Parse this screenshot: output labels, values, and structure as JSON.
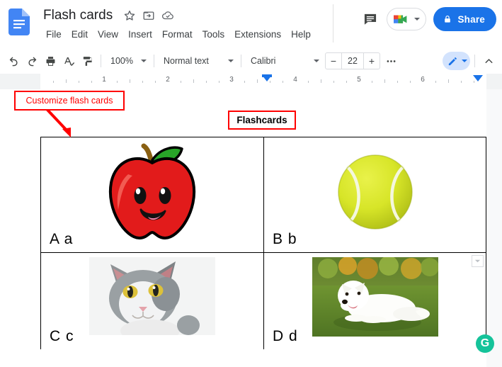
{
  "app": {
    "name": "Google Docs",
    "doc_title": "Flash cards",
    "docs_icon": "google-docs-icon"
  },
  "title_bar": {
    "icons": [
      {
        "name": "star-icon",
        "label": "Star"
      },
      {
        "name": "move-folder-icon",
        "label": "Move"
      },
      {
        "name": "cloud-saved-icon",
        "label": "Saved to Drive"
      }
    ]
  },
  "menu": {
    "items": [
      {
        "id": "file",
        "label": "File"
      },
      {
        "id": "edit",
        "label": "Edit"
      },
      {
        "id": "view",
        "label": "View"
      },
      {
        "id": "insert",
        "label": "Insert"
      },
      {
        "id": "format",
        "label": "Format"
      },
      {
        "id": "tools",
        "label": "Tools"
      },
      {
        "id": "extensions",
        "label": "Extensions"
      },
      {
        "id": "help",
        "label": "Help"
      }
    ]
  },
  "header_actions": {
    "comment_icon": "comment-icon",
    "meet_icon": "google-meet-icon",
    "share_label": "Share",
    "share_lock_icon": "lock-icon",
    "share_color": "#1a73e8"
  },
  "toolbar": {
    "undo_icon": "undo-icon",
    "redo_icon": "redo-icon",
    "print_icon": "print-icon",
    "spellcheck_icon": "spellcheck-icon",
    "paint_format_icon": "paint-format-icon",
    "zoom_value": "100%",
    "paragraph_style": "Normal text",
    "font_family": "Calibri",
    "font_size": "22",
    "decrease_font_label": "−",
    "increase_font_label": "+",
    "more_icon": "more-options-icon",
    "mode_icon": "edit-pencil-icon",
    "mode_accent": "#d3e3fd",
    "collapse_icon": "chevron-up-icon"
  },
  "ruler": {
    "numbers": [
      "1",
      "2",
      "3",
      "4",
      "5",
      "6"
    ],
    "left_indent_marker": "indent-marker",
    "right_indent_marker": "indent-marker"
  },
  "annotations": [
    {
      "id": "customize-note",
      "text": "Customize flash cards",
      "color": "#ff0000",
      "arrow": "arrow-down-right"
    }
  ],
  "document": {
    "heading": "Flashcards",
    "heading_highlight_color": "#ff0000",
    "table": {
      "rows": [
        {
          "cells": [
            {
              "id": "card-a",
              "label": "A a",
              "image": "apple-cartoon-image",
              "image_alt": "Red cartoon apple with smiling face"
            },
            {
              "id": "card-b",
              "label": "B b",
              "image": "tennis-ball-image",
              "image_alt": "Yellow-green tennis ball"
            }
          ]
        },
        {
          "cells": [
            {
              "id": "card-c",
              "label": "C c",
              "image": "cat-photo-image",
              "image_alt": "Gray and white cat face photo"
            },
            {
              "id": "card-d",
              "label": "D d",
              "image": "dog-photo-image",
              "image_alt": "White puppy lying on green grass"
            }
          ]
        }
      ],
      "collapse_icon": "table-collapse-icon"
    }
  },
  "overlay": {
    "grammarly_letter": "G",
    "grammarly_name": "grammarly-icon",
    "grammarly_color": "#15c39a"
  }
}
